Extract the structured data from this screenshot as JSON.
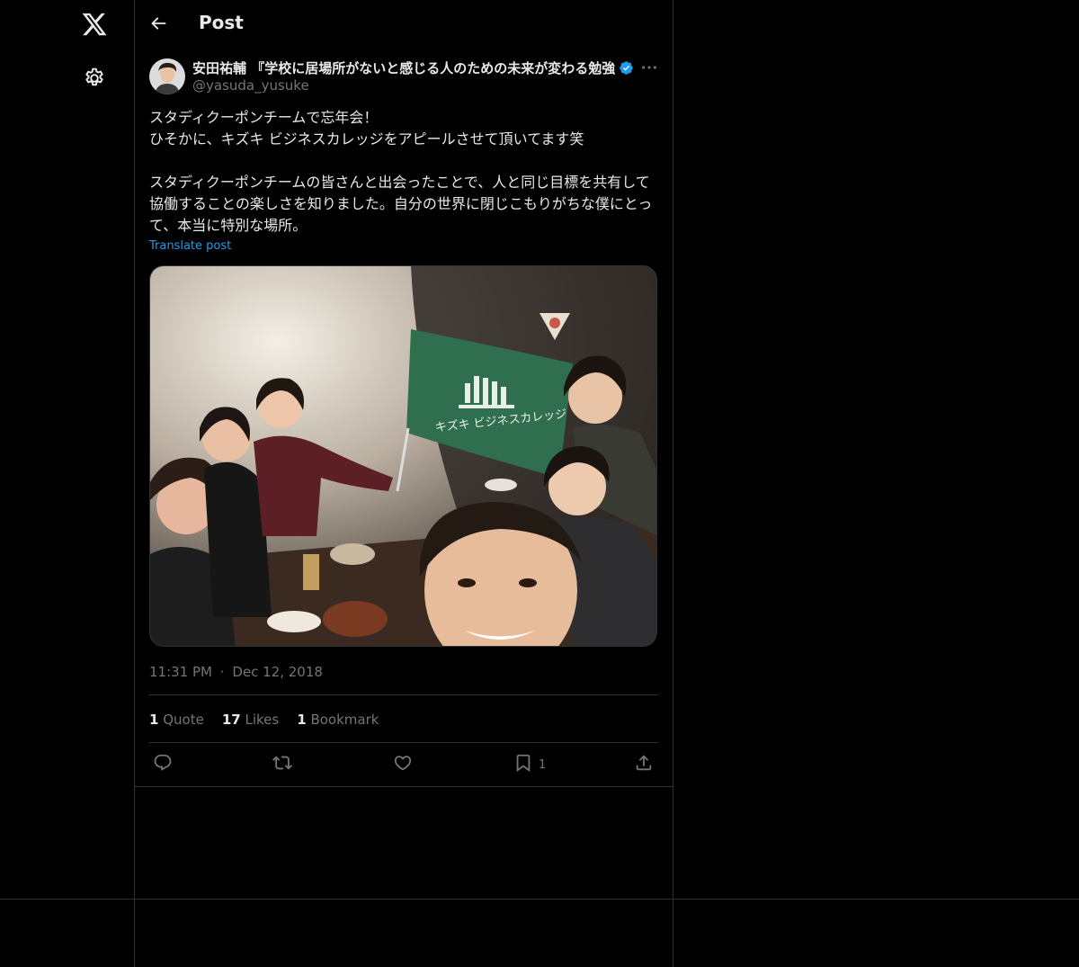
{
  "nav": {
    "logo_icon": "x-logo-icon",
    "settings_icon": "gear-icon"
  },
  "header": {
    "back_icon": "arrow-left-icon",
    "title": "Post"
  },
  "post": {
    "author_name": "安田祐輔 『学校に居場所がないと感じる人のための未来が変わる勉強法』",
    "verified_icon": "verified-badge-icon",
    "more_icon": "more-horizontal-icon",
    "handle": "@yasuda_yusuke",
    "text_line1": "スタディクーポンチームで忘年会！",
    "text_line2": "ひそかに、キズキ ビジネスカレッジをアピールさせて頂いてます笑",
    "text_line3": "スタディクーポンチームの皆さんと出会ったことで、人と同じ目標を共有して協働することの楽しさを知りました。自分の世界に閉じこもりがちな僕にとって、本当に特別な場所。",
    "translate_label": "Translate post",
    "photo_flag_text": "キズキ ビジネスカレッジ",
    "time": "11:31 PM",
    "separator": "·",
    "date": "Dec 12, 2018"
  },
  "stats": {
    "quotes_count": "1",
    "quotes_label": "Quote",
    "likes_count": "17",
    "likes_label": "Likes",
    "bookmarks_count": "1",
    "bookmarks_label": "Bookmark"
  },
  "actions": {
    "reply_icon": "reply-icon",
    "repost_icon": "repost-icon",
    "like_icon": "heart-icon",
    "bookmark_icon": "bookmark-icon",
    "bookmark_count": "1",
    "share_icon": "share-icon"
  },
  "colors": {
    "background": "#000000",
    "text": "#e7e9ea",
    "muted": "#71767b",
    "link": "#1d9bf0",
    "border": "#2f3336",
    "flag_green": "#2f6f4f"
  }
}
